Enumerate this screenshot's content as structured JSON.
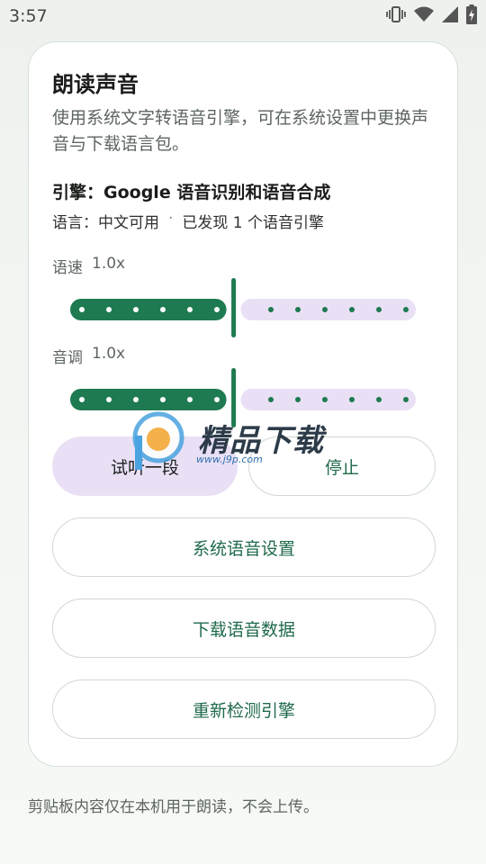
{
  "status_bar": {
    "time": "3:57",
    "icons": [
      "vibrate-icon",
      "wifi-icon",
      "signal-icon",
      "battery-charging-icon"
    ]
  },
  "card": {
    "title": "朗读声音",
    "description": "使用系统文字转语音引擎，可在系统设置中更换声音与下载语言包。",
    "engine": "引擎：Google 语音识别和语音合成",
    "language": "语言：中文可用",
    "language_sep": "·",
    "engines_found": "已发现 1 个语音引擎"
  },
  "speed": {
    "label": "语速",
    "value_text": "1.0x",
    "value": 1.0,
    "fraction": 0.4
  },
  "pitch": {
    "label": "音调",
    "value_text": "1.0x",
    "value": 1.0,
    "fraction": 0.4
  },
  "buttons": {
    "preview": "试听一段",
    "stop": "停止",
    "system_settings": "系统语音设置",
    "download_data": "下载语音数据",
    "redetect": "重新检测引擎"
  },
  "footer": "剪贴板内容仅在本机用于朗读，不会上传。",
  "watermark": {
    "text": "精品下载",
    "url": "www.j9p.com"
  },
  "colors": {
    "accent": "#1e7a50",
    "track_inactive": "#e9e0f5",
    "tonal_button": "#e9e0f5"
  }
}
